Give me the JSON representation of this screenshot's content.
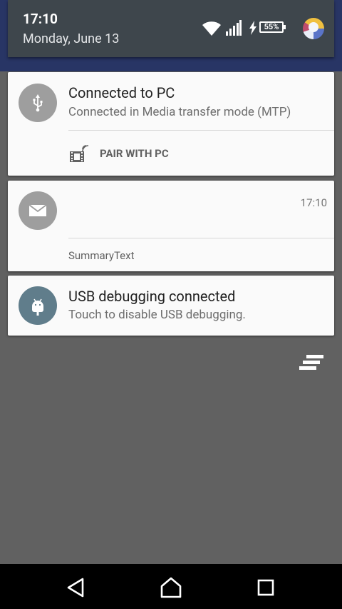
{
  "status_bar": {
    "time": "17:10",
    "date": "Monday, June 13",
    "battery_percent": "55%"
  },
  "notifications": [
    {
      "title": "Connected to PC",
      "text": "Connected in Media transfer mode (MTP)",
      "action_label": "PAIR WITH PC",
      "icon": "usb-icon"
    },
    {
      "time": "17:10",
      "summary": "SummaryText",
      "icon": "email-icon"
    },
    {
      "title": "USB debugging connected",
      "text": "Touch to disable USB debugging.",
      "icon": "android-icon"
    }
  ],
  "navigation": {
    "buttons": [
      "back-icon",
      "home-icon",
      "recents-icon"
    ]
  },
  "colors": {
    "header_bg": "#3e464c",
    "top_strip": "#283565",
    "scrim": "#616161",
    "card_bg": "#fafafa",
    "icon_grey": "#9e9e9e",
    "icon_slate": "#607d8b"
  }
}
